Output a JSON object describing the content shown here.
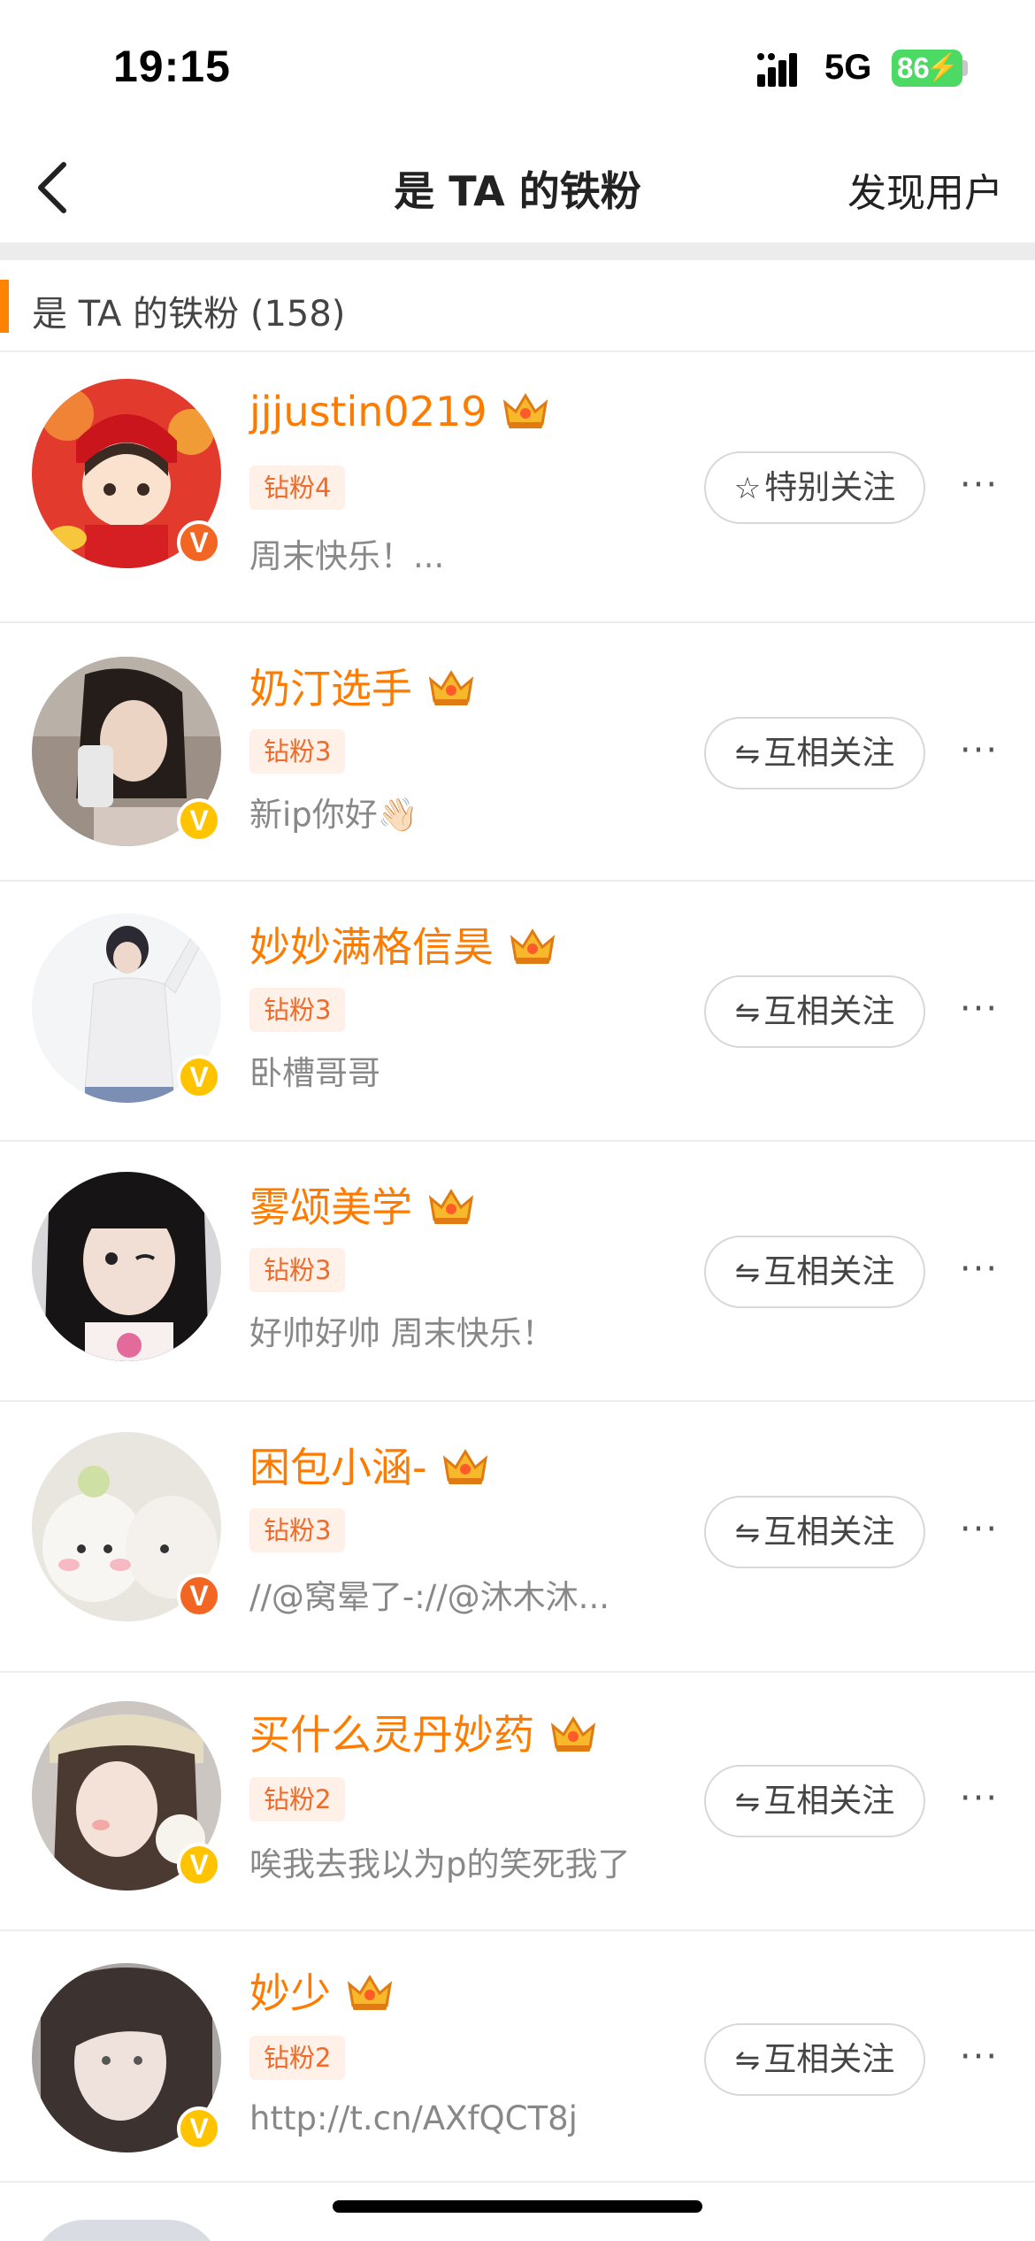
{
  "status_bar": {
    "time": "19:15",
    "network": "5G",
    "battery": "86"
  },
  "nav": {
    "title": "是 TA 的铁粉",
    "right_action": "发现用户"
  },
  "section": {
    "title": "是 TA 的铁粉 (158)"
  },
  "users": [
    {
      "name": "jjjustin0219",
      "crown_level": "9",
      "badge": "钻粉4",
      "desc": "周末快乐！...",
      "button_icon": "☆",
      "button": "特别关注",
      "verify": "red"
    },
    {
      "name": "奶汀选手",
      "crown_level": "6",
      "badge": "钻粉3",
      "desc": "新ip你好👋🏻",
      "button_icon": "⇋",
      "button": "互相关注",
      "verify": "gold"
    },
    {
      "name": "妙妙满格信昊",
      "crown_level": "6",
      "badge": "钻粉3",
      "desc": "卧槽哥哥",
      "button_icon": "⇋",
      "button": "互相关注",
      "verify": "gold"
    },
    {
      "name": "雾颂美学",
      "crown_level": "",
      "badge": "钻粉3",
      "desc": "好帅好帅 周末快乐！",
      "button_icon": "⇋",
      "button": "互相关注",
      "verify": "none"
    },
    {
      "name": "困包小涵-",
      "crown_level": "6",
      "badge": "钻粉3",
      "desc": "//@窝晕了-://@沐木沐...",
      "button_icon": "⇋",
      "button": "互相关注",
      "verify": "red"
    },
    {
      "name": "买什么灵丹妙药",
      "crown_level": "6",
      "badge": "钻粉2",
      "desc": "唉我去我以为p的笑死我了",
      "button_icon": "⇋",
      "button": "互相关注",
      "verify": "gold"
    },
    {
      "name": "妙少",
      "crown_level": "6",
      "badge": "钻粉2",
      "desc": "http://t.cn/AXfQCT8j",
      "button_icon": "⇋",
      "button": "互相关注",
      "verify": "gold"
    }
  ],
  "more_label": "···",
  "verify_mark": "V",
  "colors": {
    "accent": "#ff8200",
    "username": "#ff7b00",
    "verify_red": "#f26522",
    "verify_gold": "#ffc300",
    "battery": "#4cd964"
  }
}
